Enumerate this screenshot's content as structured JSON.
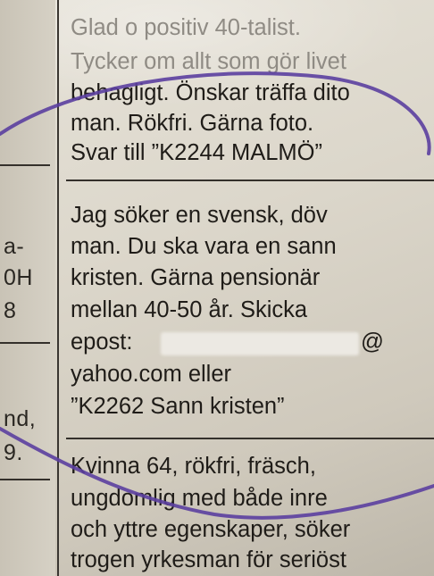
{
  "ad_column": {
    "ad1": [
      "Glad o positiv 40-talist.",
      "Tycker om allt som gör livet",
      "behagligt. Önskar  träffa dito",
      "man. Rökfri. Gärna foto.",
      "Svar till ”K2244 MALMÖ”"
    ],
    "ad2": [
      "Jag söker en svensk, döv",
      "man. Du ska vara en sann",
      "kristen. Gärna pensionär",
      "mellan 40-50 år. Skicka",
      "epost:",
      "@",
      "yahoo.com eller",
      "”K2262 Sann kristen”"
    ],
    "ad3": [
      "Kvinna 64, rökfri, fräsch,",
      "ungdomlig med både inre",
      "och yttre egenskaper, söker",
      "trogen yrkesman för seriöst"
    ]
  },
  "left_fragments": [
    "a-",
    "0H",
    "8",
    "nd,",
    "9."
  ],
  "colors": {
    "ink_circle": "#5b3fa0",
    "paper": "#dcd7cb",
    "text": "#1f1c18"
  }
}
